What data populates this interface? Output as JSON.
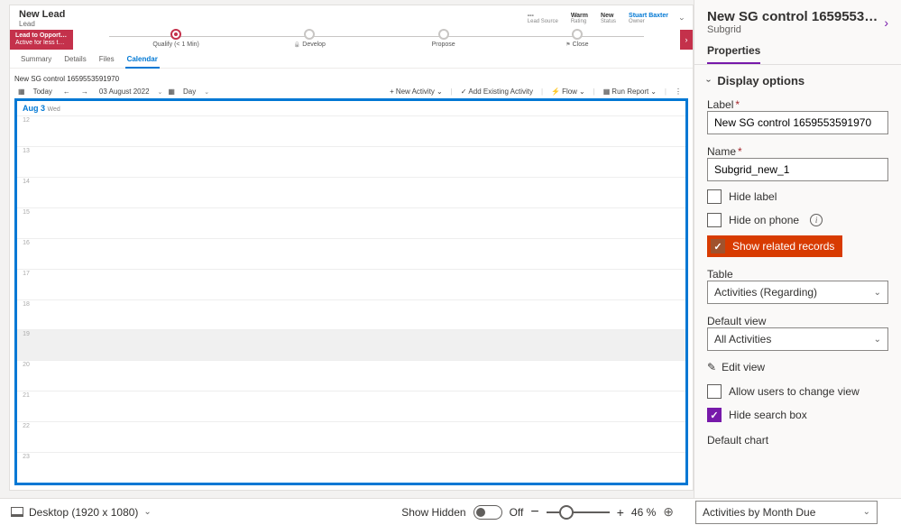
{
  "form": {
    "title": "New Lead",
    "subtitle": "Lead",
    "headerFields": [
      {
        "value": "---",
        "label": "Lead Source",
        "link": false
      },
      {
        "value": "Warm",
        "label": "Rating",
        "link": false
      },
      {
        "value": "New",
        "label": "Status",
        "link": false
      },
      {
        "value": "Stuart Baxter",
        "label": "Owner",
        "link": true
      }
    ]
  },
  "process": {
    "badgeTitle": "Lead to Opportunity Sal...",
    "badgeCaption": "Active for less than one mi...",
    "stages": [
      {
        "label": "Qualify (< 1 Min)",
        "active": true,
        "lock": false,
        "flag": false
      },
      {
        "label": "Develop",
        "active": false,
        "lock": true,
        "flag": false
      },
      {
        "label": "Propose",
        "active": false,
        "lock": false,
        "flag": false
      },
      {
        "label": "Close",
        "active": false,
        "lock": false,
        "flag": true
      }
    ]
  },
  "tabs": [
    "Summary",
    "Details",
    "Files",
    "Calendar"
  ],
  "activeTab": "Calendar",
  "subgrid": {
    "title": "New SG control 1659553591970",
    "toolbar": {
      "today": "Today",
      "date": "03 August 2022",
      "view": "Day",
      "newActivity": "New Activity",
      "addExisting": "Add Existing Activity",
      "flow": "Flow",
      "runReport": "Run Report"
    },
    "dayHeader": {
      "date": "Aug 3",
      "weekday": "Wed"
    },
    "hours": [
      "12",
      "13",
      "14",
      "15",
      "16",
      "17",
      "18",
      "19",
      "20",
      "21",
      "22",
      "23"
    ],
    "currentHourIndex": 7
  },
  "propPanel": {
    "title": "New SG control 16595535919...",
    "subtitle": "Subgrid",
    "tab": "Properties",
    "section": "Display options",
    "labelField": {
      "label": "Label",
      "value": "New SG control 1659553591970"
    },
    "nameField": {
      "label": "Name",
      "value": "Subgrid_new_1"
    },
    "hideLabel": {
      "label": "Hide label",
      "checked": false
    },
    "hidePhone": {
      "label": "Hide on phone",
      "checked": false
    },
    "showRelated": {
      "label": "Show related records",
      "checked": true
    },
    "tableField": {
      "label": "Table",
      "value": "Activities (Regarding)"
    },
    "defaultView": {
      "label": "Default view",
      "value": "All Activities"
    },
    "editView": "Edit view",
    "allowChange": {
      "label": "Allow users to change view",
      "checked": false
    },
    "hideSearch": {
      "label": "Hide search box",
      "checked": true
    },
    "defaultChart": {
      "label": "Default chart",
      "value": "Activities by Month Due"
    }
  },
  "footer": {
    "resolution": "Desktop (1920 x 1080)",
    "showHidden": "Show Hidden",
    "toggleState": "Off",
    "zoom": "46 %"
  }
}
